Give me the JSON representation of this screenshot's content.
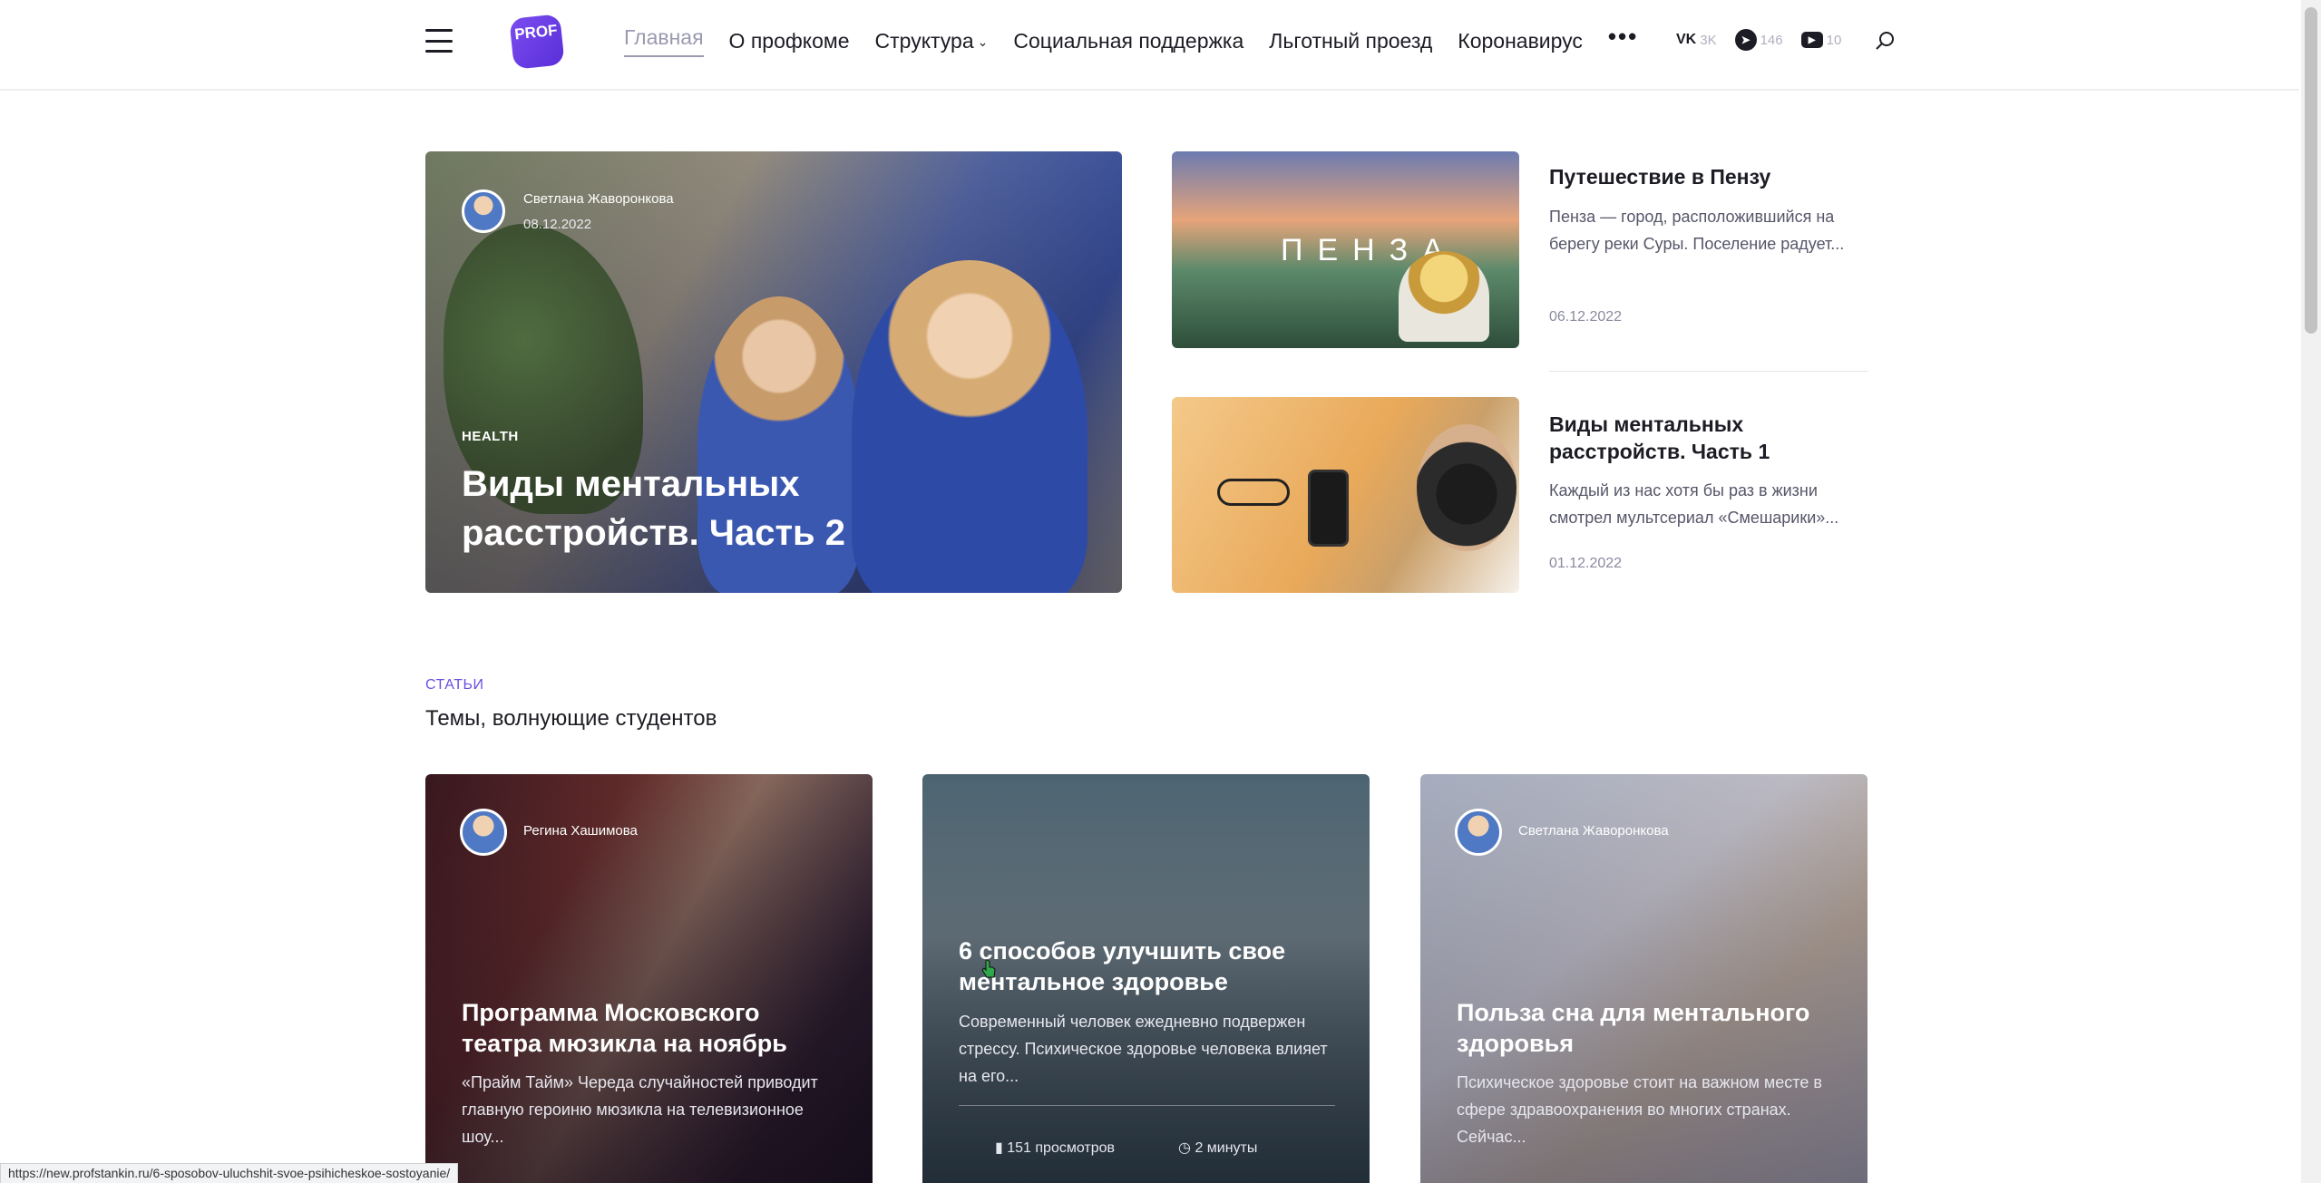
{
  "header": {
    "logo_text": "PROF",
    "nav": [
      {
        "label": "Главная",
        "active": true
      },
      {
        "label": "О профкоме"
      },
      {
        "label": "Структура"
      },
      {
        "label": "Социальная поддержка"
      },
      {
        "label": "Льготный проезд"
      },
      {
        "label": "Коронавирус"
      }
    ],
    "more_label": "•••",
    "social": [
      {
        "icon": "vk-icon",
        "glyph": "VK",
        "count": "3K"
      },
      {
        "icon": "telegram-icon",
        "glyph": "➤",
        "count": "146"
      },
      {
        "icon": "youtube-icon",
        "glyph": "▶",
        "count": "10"
      }
    ]
  },
  "hero": {
    "author": "Светлана Жаворонкова",
    "date": "08.12.2022",
    "category": "HEALTH",
    "title": "Виды ментальных расстройств. Часть 2"
  },
  "side_articles": [
    {
      "image_text": "ПЕНЗА",
      "title": "Путешествие в Пензу",
      "excerpt": "Пенза — город, расположившийся на берегу реки Суры. Поселение радует...",
      "date": "06.12.2022"
    },
    {
      "title": "Виды ментальных расстройств. Часть 1",
      "excerpt": "Каждый из нас хотя бы раз в жизни смотрел мультсериал «Смешарики»...",
      "date": "01.12.2022"
    }
  ],
  "section": {
    "label": "СТАТЬИ",
    "title": "Темы, волнующие студентов"
  },
  "cards": [
    {
      "author": "Регина Хашимова",
      "title": "Программа Московского театра мюзикла на ноябрь",
      "excerpt": "«Прайм Тайм» Череда случайностей приводит главную героиню мюзикла на телевизионное шоу..."
    },
    {
      "title": "6 способов улучшить свое ментальное здоровье",
      "excerpt": "Современный человек ежедневно подвержен стрессу. Психическое здоровье человека влияет на его...",
      "views": "151 просмотров",
      "read_time": "2 минуты"
    },
    {
      "author": "Светлана Жаворонкова",
      "title": "Польза сна для ментального здоровья",
      "excerpt": "Психическое здоровье стоит на важном месте в сфере здравоохранения во многих странах. Сейчас..."
    }
  ],
  "status_url": "https://new.profstankin.ru/6-sposobov-uluchshit-svoe-psihicheskoe-sostoyanie/",
  "colors": {
    "accent": "#6d4ee0",
    "text": "#1c1c24",
    "muted": "#8a8aa0"
  }
}
